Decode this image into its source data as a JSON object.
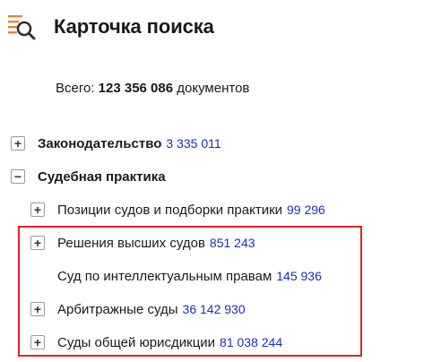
{
  "header": {
    "title": "Карточка поиска",
    "logo_icon": "search-list-icon"
  },
  "total": {
    "prefix": "Всего:",
    "value": "123 356 086",
    "suffix": "документов"
  },
  "tree": {
    "items": [
      {
        "label": "Законодательство",
        "count": "3 335 011",
        "toggle": "+"
      },
      {
        "label": "Судебная практика",
        "count": "",
        "toggle": "−"
      },
      {
        "label": "Позиции судов и подборки практики",
        "count": "99 296",
        "toggle": "+"
      },
      {
        "label": "Решения высших судов",
        "count": "851 243",
        "toggle": "+"
      },
      {
        "label": "Суд по интеллектуальным правам",
        "count": "145 936",
        "toggle": ""
      },
      {
        "label": "Арбитражные суды",
        "count": "36 142 930",
        "toggle": "+"
      },
      {
        "label": "Суды общей юрисдикции",
        "count": "81 038 244",
        "toggle": "+"
      }
    ]
  },
  "colors": {
    "accent_orange": "#e8873a",
    "count_blue": "#1a2fb8",
    "highlight_red": "#e1212b"
  }
}
